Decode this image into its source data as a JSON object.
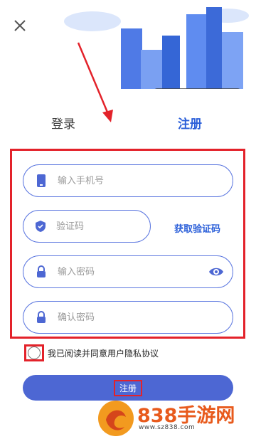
{
  "tabs": {
    "login": "登录",
    "register": "注册"
  },
  "fields": {
    "phone_placeholder": "输入手机号",
    "code_placeholder": "验证码",
    "password_placeholder": "输入密码",
    "confirm_placeholder": "确认密码"
  },
  "get_code_label": "获取验证码",
  "agreement_text": "我已阅读并同意用户隐私协议",
  "submit_label": "注册",
  "watermark": {
    "brand": "838手游网",
    "url": "www.sz838.com"
  },
  "colors": {
    "accent": "#2b5fd9",
    "button": "#4d67d3",
    "annotation": "#e3222a"
  }
}
